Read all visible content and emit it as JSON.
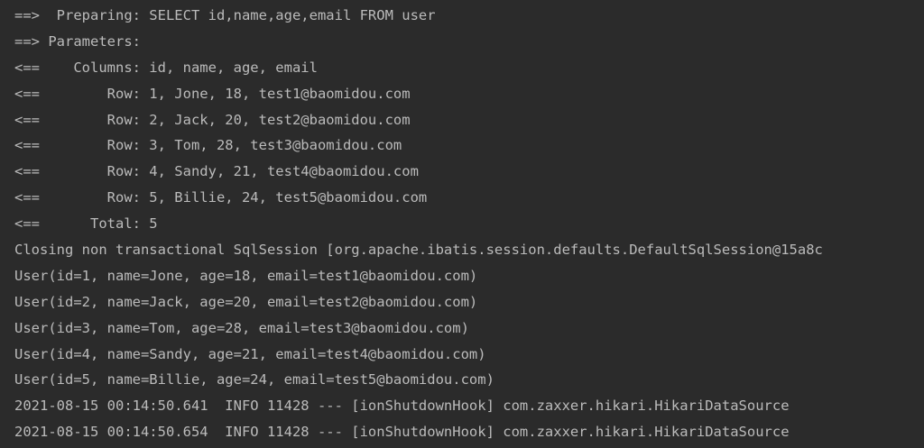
{
  "console": {
    "lines": [
      "==>  Preparing: SELECT id,name,age,email FROM user",
      "==> Parameters: ",
      "<==    Columns: id, name, age, email",
      "<==        Row: 1, Jone, 18, test1@baomidou.com",
      "<==        Row: 2, Jack, 20, test2@baomidou.com",
      "<==        Row: 3, Tom, 28, test3@baomidou.com",
      "<==        Row: 4, Sandy, 21, test4@baomidou.com",
      "<==        Row: 5, Billie, 24, test5@baomidou.com",
      "<==      Total: 5",
      "Closing non transactional SqlSession [org.apache.ibatis.session.defaults.DefaultSqlSession@15a8c",
      "User(id=1, name=Jone, age=18, email=test1@baomidou.com)",
      "User(id=2, name=Jack, age=20, email=test2@baomidou.com)",
      "User(id=3, name=Tom, age=28, email=test3@baomidou.com)",
      "User(id=4, name=Sandy, age=21, email=test4@baomidou.com)",
      "User(id=5, name=Billie, age=24, email=test5@baomidou.com)",
      "2021-08-15 00:14:50.641  INFO 11428 --- [ionShutdownHook] com.zaxxer.hikari.HikariDataSource",
      "2021-08-15 00:14:50.654  INFO 11428 --- [ionShutdownHook] com.zaxxer.hikari.HikariDataSource"
    ]
  },
  "colors": {
    "background": "#2b2b2b",
    "text": "#bbbbbb"
  }
}
